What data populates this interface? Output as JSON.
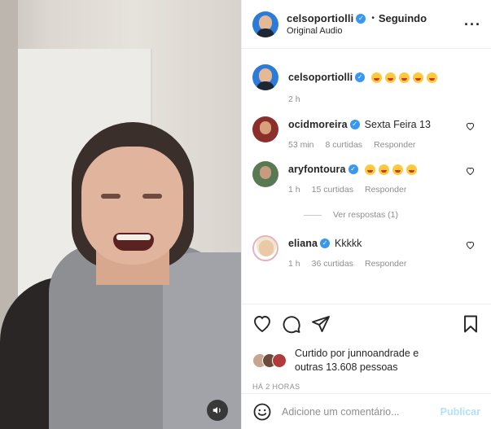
{
  "video": {
    "mute_icon": "speaker-icon"
  },
  "header": {
    "username": "celsoportiolli",
    "separator": "•",
    "follow_state": "Seguindo",
    "audio": "Original Audio",
    "more_icon": "more-options-icon"
  },
  "caption": {
    "username": "celsoportiolli",
    "emoji_count": 5,
    "time": "2 h"
  },
  "comments": [
    {
      "username": "ocidmoreira",
      "text": "Sexta Feira 13",
      "time": "53 min",
      "likes": "8 curtidas",
      "reply": "Responder"
    },
    {
      "username": "aryfontoura",
      "text": "",
      "emoji_count": 4,
      "time": "1 h",
      "likes": "15 curtidas",
      "reply": "Responder",
      "view_replies": "Ver respostas (1)"
    },
    {
      "username": "eliana",
      "text": "Kkkkk",
      "time": "1 h",
      "likes": "36 curtidas",
      "reply": "Responder"
    }
  ],
  "likes": {
    "line1": "Curtido por junnoandrade e",
    "line2": "outras 13.608 pessoas"
  },
  "posted": "HÁ 2 HORAS",
  "add_comment": {
    "placeholder": "Adicione um comentário...",
    "publish": "Publicar"
  },
  "colors": {
    "verified": "#3897f0",
    "publish_disabled": "#b2dffc",
    "meta": "#8e8e8e"
  }
}
